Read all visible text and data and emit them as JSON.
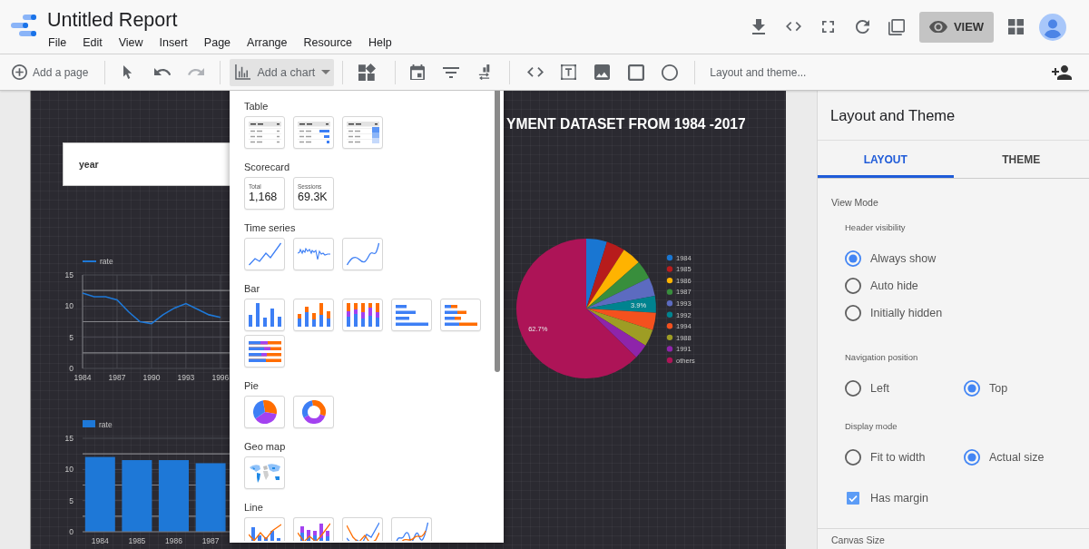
{
  "header": {
    "title": "Untitled Report",
    "menu": [
      "File",
      "Edit",
      "View",
      "Insert",
      "Page",
      "Arrange",
      "Resource",
      "Help"
    ],
    "view_button": "VIEW"
  },
  "toolbar": {
    "add_page": "Add a page",
    "undo": {
      "disabled": false
    },
    "redo": {
      "disabled": true
    },
    "add_chart": {
      "label": "Add a chart",
      "expanded": true,
      "menu": {
        "sections": [
          {
            "label": "Table",
            "options": [
              {
                "kind": "table"
              },
              {
                "kind": "table-bars"
              },
              {
                "kind": "table-heatmap"
              }
            ]
          },
          {
            "label": "Scorecard",
            "options": [
              {
                "kind": "scorecard",
                "label": "Total",
                "value": "1,168"
              },
              {
                "kind": "scorecard",
                "label": "Sessions",
                "value": "69.3K"
              }
            ]
          },
          {
            "label": "Time series",
            "options": [
              {
                "kind": "time-series"
              },
              {
                "kind": "sparkline"
              },
              {
                "kind": "smoothed-time-series"
              }
            ]
          },
          {
            "label": "Bar",
            "options": [
              {
                "kind": "column"
              },
              {
                "kind": "stacked-column"
              },
              {
                "kind": "stacked-column-100"
              },
              {
                "kind": "bar"
              },
              {
                "kind": "stacked-bar"
              },
              {
                "kind": "stacked-bar-100"
              }
            ]
          },
          {
            "label": "Pie",
            "options": [
              {
                "kind": "pie"
              },
              {
                "kind": "donut"
              }
            ]
          },
          {
            "label": "Geo map",
            "options": [
              {
                "kind": "geo"
              }
            ]
          },
          {
            "label": "Line",
            "options": [
              {
                "kind": "combo"
              },
              {
                "kind": "stacked-combo"
              },
              {
                "kind": "line"
              },
              {
                "kind": "smoothed-line"
              }
            ]
          }
        ]
      }
    },
    "layout_theme": "Layout and theme..."
  },
  "canvas": {
    "title": "YMENT DATASET FROM 1984 -2017",
    "filter": {
      "label": "year"
    },
    "line_chart": {
      "chart_data": {
        "type": "line",
        "x": [
          1984,
          1985,
          1986,
          1987,
          1988,
          1989,
          1990,
          1991,
          1992,
          1993,
          1994,
          1995,
          1996
        ],
        "series": [
          {
            "name": "rate",
            "color": "#1e78d7",
            "values": [
              12.1,
              11.5,
              11.5,
              11.0,
              9.1,
              7.5,
              7.2,
              8.6,
              9.7,
              10.4,
              9.5,
              8.6,
              8.2
            ]
          }
        ],
        "xlim": [
          1984,
          1996.8
        ],
        "xticks": [
          1984,
          1987,
          1990,
          1993,
          1996
        ],
        "ylim": [
          0,
          15
        ],
        "yticks": [
          0,
          5,
          10,
          15
        ],
        "grid": true,
        "legend": "top"
      }
    },
    "pie_chart": {
      "chart_data": {
        "type": "pie",
        "categories": [
          "1984",
          "1985",
          "1986",
          "1987",
          "1993",
          "1992",
          "1994",
          "1988",
          "1991",
          "others"
        ],
        "values": [
          4.8,
          4.3,
          4.4,
          4.3,
          4.3,
          3.9,
          4.0,
          3.9,
          3.4,
          62.7
        ],
        "colors": [
          "#1976d2",
          "#b71c1c",
          "#ffb300",
          "#388e3c",
          "#5c6bc0",
          "#00838f",
          "#f4511e",
          "#9e9d24",
          "#8e24aa",
          "#ad1457"
        ],
        "value_labels": [
          null,
          null,
          null,
          null,
          null,
          "3.9%",
          null,
          null,
          null,
          "62.7%"
        ],
        "legend": "right"
      }
    },
    "bar_chart": {
      "chart_data": {
        "type": "bar",
        "categories": [
          "1984",
          "1985",
          "1986",
          "1987"
        ],
        "series": [
          {
            "name": "rate",
            "color": "#1e78d7",
            "values": [
              12.0,
              11.5,
              11.5,
              11.0
            ]
          }
        ],
        "ylim": [
          0,
          15
        ],
        "yticks": [
          0,
          5,
          10,
          15
        ],
        "grid": true,
        "legend": "top"
      }
    }
  },
  "panel": {
    "title": "Layout and Theme",
    "tabs": [
      {
        "label": "LAYOUT",
        "selected": true
      },
      {
        "label": "THEME",
        "selected": false
      }
    ],
    "section": "View Mode",
    "groups": [
      {
        "label": "Header visibility",
        "options": [
          {
            "label": "Always show",
            "selected": true
          },
          {
            "label": "Auto hide",
            "selected": false
          },
          {
            "label": "Initially hidden",
            "selected": false
          }
        ]
      },
      {
        "label": "Navigation position",
        "options": [
          {
            "label": "Left",
            "selected": false
          },
          {
            "label": "Top",
            "selected": true
          }
        ]
      },
      {
        "label": "Display mode",
        "options": [
          {
            "label": "Fit to width",
            "selected": false
          },
          {
            "label": "Actual size",
            "selected": true
          }
        ]
      }
    ],
    "has_margin": {
      "label": "Has margin",
      "checked": true
    },
    "next_section": "Canvas Size"
  }
}
